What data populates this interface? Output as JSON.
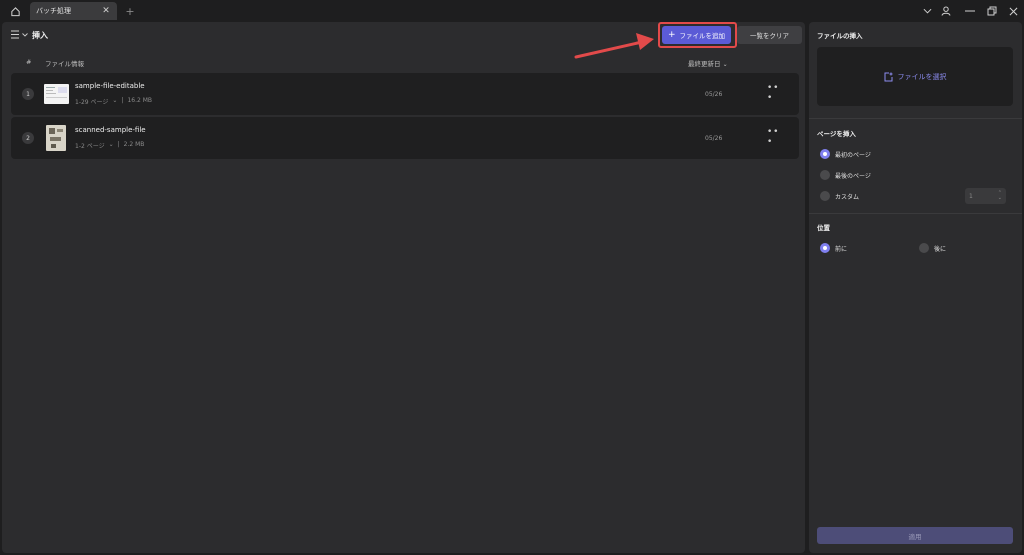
{
  "titlebar": {
    "tab_title": "バッチ処理",
    "icons": [
      "home-icon",
      "close-icon",
      "plus-icon",
      "chevron-down-icon",
      "user-icon",
      "minimize-icon",
      "restore-icon",
      "close-icon"
    ]
  },
  "main": {
    "title": "挿入",
    "add_files_label": "ファイルを追加",
    "clear_list_label": "一覧をクリア",
    "columns": {
      "hash": "#",
      "file_info": "ファイル情報",
      "last_modified": "最終更新日"
    },
    "files": [
      {
        "index": "1",
        "name": "sample-file-editable",
        "pages": "1-29 ページ",
        "size": "16.2 MB",
        "date": "05/26"
      },
      {
        "index": "2",
        "name": "scanned-sample-file",
        "pages": "1-2 ページ",
        "size": "2.2 MB",
        "date": "05/26"
      }
    ]
  },
  "side": {
    "insert_file_title": "ファイルの挿入",
    "select_file_label": "ファイルを選択",
    "insert_page_title": "ページを挿入",
    "insert_page_options": [
      "最初のページ",
      "最後のページ",
      "カスタム"
    ],
    "insert_page_selected": "最初のページ",
    "custom_page_value": "1",
    "position_title": "位置",
    "position_options": [
      "前に",
      "後に"
    ],
    "position_selected": "前に",
    "apply_label": "適用"
  },
  "colors": {
    "accent": "#5b5bd6",
    "highlight_box": "#e24a4a",
    "panel_bg": "#2c2c2e",
    "row_bg": "#1f1f20"
  }
}
